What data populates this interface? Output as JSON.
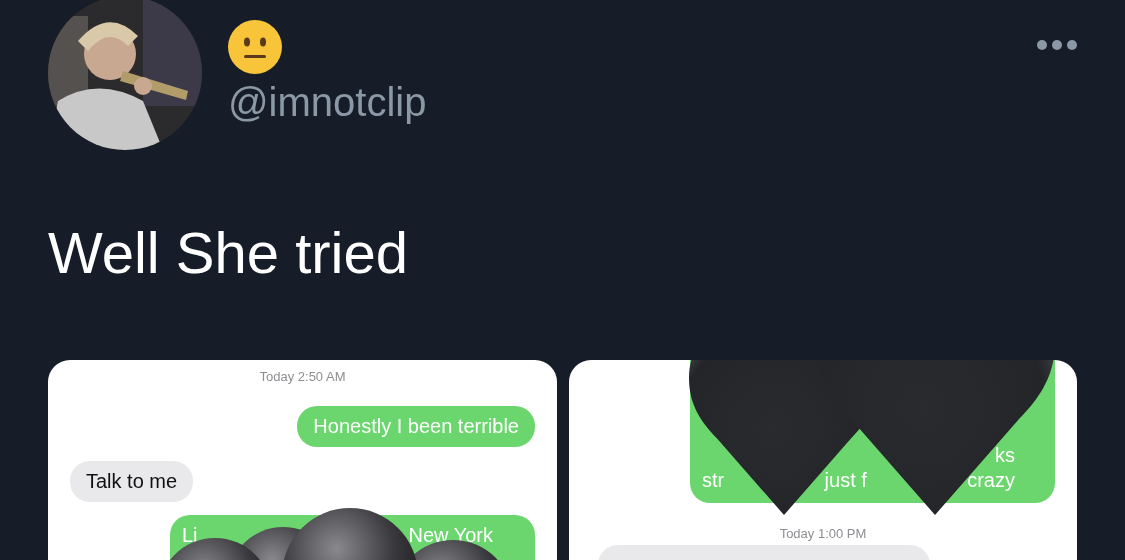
{
  "tweet": {
    "author": {
      "handle": "@imnotclip"
    },
    "text": "Well She tried",
    "media": [
      {
        "messages": [
          {
            "kind": "timestamp",
            "text": "Today 2:50 AM"
          },
          {
            "kind": "sent",
            "lines": [
              [
                "Honestly I been terrible"
              ]
            ]
          },
          {
            "kind": "received",
            "lines": [
              [
                "Talk to me"
              ]
            ]
          },
          {
            "kind": "sent",
            "lines": [
              [
                "Li",
                "New York"
              ]
            ]
          }
        ]
      },
      {
        "messages": [
          {
            "kind": "sent",
            "lines": [
              [
                "ks"
              ],
              [
                "str",
                "just f",
                "crazy"
              ]
            ]
          },
          {
            "kind": "timestamp",
            "text": "Today 1:00 PM"
          },
          {
            "kind": "received"
          }
        ]
      }
    ]
  }
}
